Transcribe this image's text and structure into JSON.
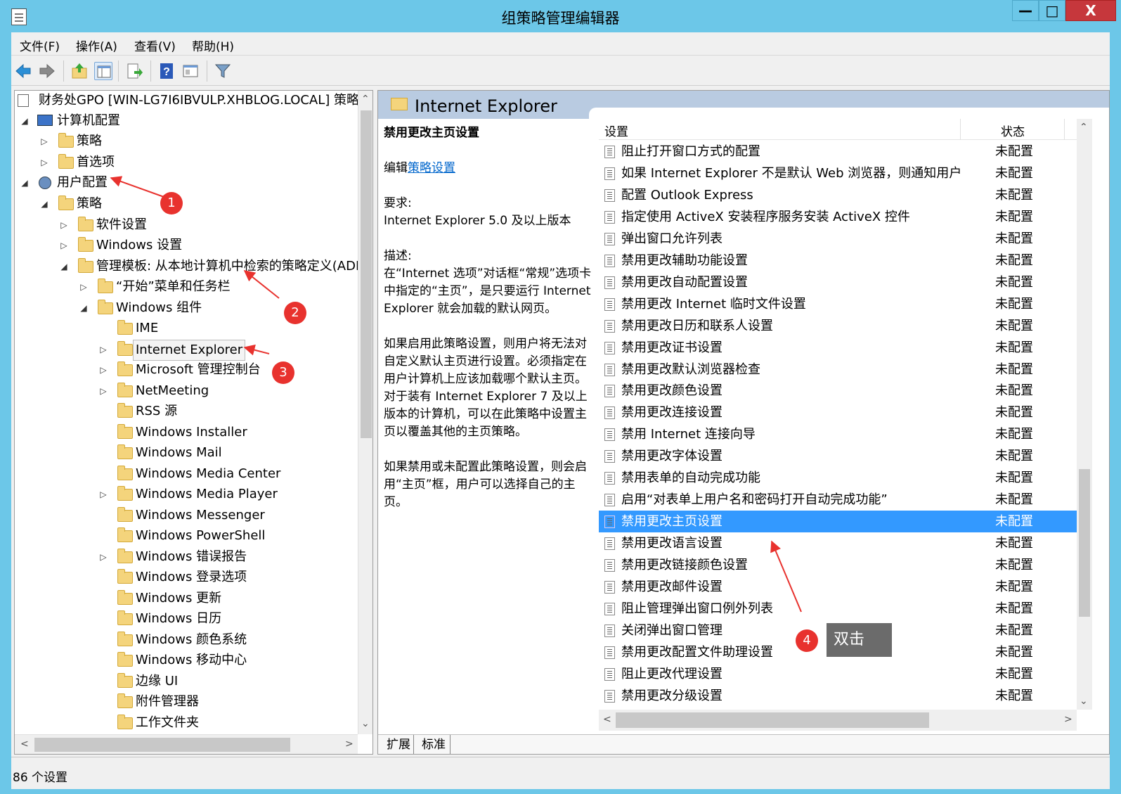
{
  "window": {
    "title": "组策略管理编辑器",
    "min": "—",
    "max": "□",
    "close": "X"
  },
  "menu": [
    "文件(F)",
    "操作(A)",
    "查看(V)",
    "帮助(H)"
  ],
  "toolbar": [
    "back-icon",
    "forward-icon",
    "up-folder-icon",
    "show-hide-tree-icon",
    "export-list-icon",
    "help-icon",
    "properties-icon",
    "filter-icon"
  ],
  "tree": {
    "root": "财务处GPO [WIN-LG7I6IBVULP.XHBLOG.LOCAL] 策略",
    "computer_config": "计算机配置",
    "policies1": "策略",
    "preferences": "首选项",
    "user_config": "用户配置",
    "policies2": "策略",
    "software_settings": "软件设置",
    "windows_settings": "Windows 设置",
    "admin_templates": "管理模板: 从本地计算机中检索的策略定义(ADM",
    "start_menu": "“开始”菜单和任务栏",
    "windows_components": "Windows 组件",
    "components": [
      "IME",
      "Internet Explorer",
      "Microsoft 管理控制台",
      "NetMeeting",
      "RSS 源",
      "Windows Installer",
      "Windows Mail",
      "Windows Media Center",
      "Windows Media Player",
      "Windows Messenger",
      "Windows PowerShell",
      "Windows 错误报告",
      "Windows 登录选项",
      "Windows 更新",
      "Windows 日历",
      "Windows 颜色系统",
      "Windows 移动中心",
      "边缘 UI",
      "附件管理器",
      "工作文件夹"
    ]
  },
  "right": {
    "title": "Internet Explorer",
    "desc_title": "禁用更改主页设置",
    "edit_prefix": "编辑",
    "edit_link": "策略设置",
    "req_label": "要求:",
    "req_value": "Internet Explorer 5.0 及以上版本",
    "desc_label": "描述:",
    "desc1": "在“Internet 选项”对话框“常规”选项卡中指定的“主页”，是只要运行 Internet Explorer 就会加载的默认网页。",
    "desc2": "如果启用此策略设置，则用户将无法对自定义默认主页进行设置。必须指定在用户计算机上应该加载哪个默认主页。对于装有 Internet Explorer 7 及以上版本的计算机，可以在此策略中设置主页以覆盖其他的主页策略。",
    "desc3": "如果禁用或未配置此策略设置，则会启用“主页”框，用户可以选择自己的主页。",
    "col_setting": "设置",
    "col_state": "状态",
    "rows": [
      {
        "name": "阻止打开窗口方式的配置",
        "state": "未配置"
      },
      {
        "name": "如果 Internet Explorer 不是默认 Web 浏览器，则通知用户",
        "state": "未配置"
      },
      {
        "name": "配置 Outlook Express",
        "state": "未配置"
      },
      {
        "name": "指定使用 ActiveX 安装程序服务安装 ActiveX 控件",
        "state": "未配置"
      },
      {
        "name": "弹出窗口允许列表",
        "state": "未配置"
      },
      {
        "name": "禁用更改辅助功能设置",
        "state": "未配置"
      },
      {
        "name": "禁用更改自动配置设置",
        "state": "未配置"
      },
      {
        "name": "禁用更改 Internet 临时文件设置",
        "state": "未配置"
      },
      {
        "name": "禁用更改日历和联系人设置",
        "state": "未配置"
      },
      {
        "name": "禁用更改证书设置",
        "state": "未配置"
      },
      {
        "name": "禁用更改默认浏览器检查",
        "state": "未配置"
      },
      {
        "name": "禁用更改颜色设置",
        "state": "未配置"
      },
      {
        "name": "禁用更改连接设置",
        "state": "未配置"
      },
      {
        "name": "禁用 Internet 连接向导",
        "state": "未配置"
      },
      {
        "name": "禁用更改字体设置",
        "state": "未配置"
      },
      {
        "name": "禁用表单的自动完成功能",
        "state": "未配置"
      },
      {
        "name": "启用“对表单上用户名和密码打开自动完成功能”",
        "state": "未配置"
      },
      {
        "name": "禁用更改主页设置",
        "state": "未配置"
      },
      {
        "name": "禁用更改语言设置",
        "state": "未配置"
      },
      {
        "name": "禁用更改链接颜色设置",
        "state": "未配置"
      },
      {
        "name": "禁用更改邮件设置",
        "state": "未配置"
      },
      {
        "name": "阻止管理弹出窗口例外列表",
        "state": "未配置"
      },
      {
        "name": "关闭弹出窗口管理",
        "state": "未配置"
      },
      {
        "name": "禁用更改配置文件助理设置",
        "state": "未配置"
      },
      {
        "name": "阻止更改代理设置",
        "state": "未配置"
      },
      {
        "name": "禁用更改分级设置",
        "state": "未配置"
      }
    ],
    "tab_extended": "扩展",
    "tab_standard": "标准"
  },
  "status": "86 个设置",
  "callouts": {
    "c1": "1",
    "c2": "2",
    "c3": "3",
    "c4": "4",
    "tip": "双击"
  },
  "colors": {
    "titlebar": "#6cc7e8",
    "selection": "#3399ff",
    "callout": "#e8322e"
  }
}
